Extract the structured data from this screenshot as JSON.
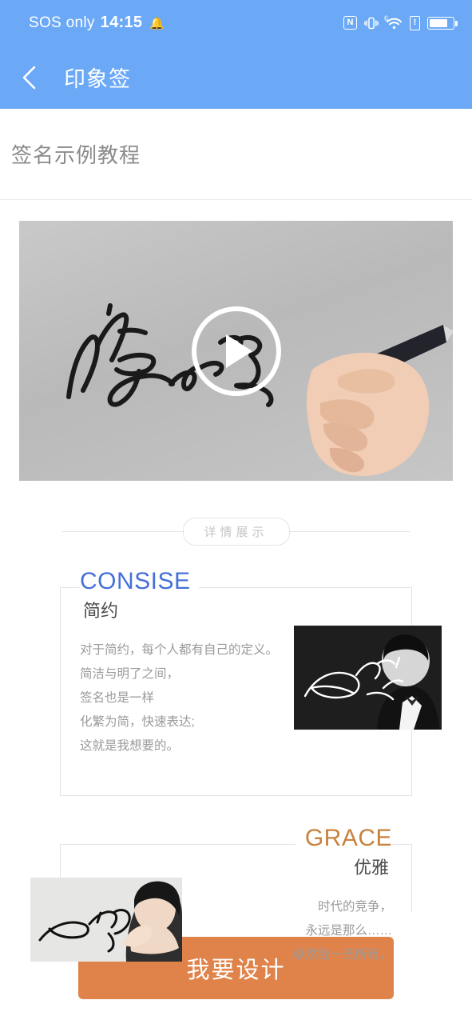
{
  "status_bar": {
    "carrier": "SOS only",
    "time": "14:15",
    "bell_icon": "bell-icon",
    "nfc_label": "N",
    "wifi_generation": "6",
    "alert_label": "!"
  },
  "nav": {
    "back_icon": "chevron-left-icon",
    "title": "印象签"
  },
  "section": {
    "title": "签名示例教程"
  },
  "video": {
    "play_icon": "play-icon",
    "alt": "手写签名演示视频"
  },
  "divider": {
    "label": "详情展示"
  },
  "cards": [
    {
      "en": "CONSISE",
      "cn": "简约",
      "accent": "#4670d8",
      "align": "left",
      "lines": [
        "对于简约，每个人都有自己的定义。",
        "简洁与明了之间，",
        "签名也是一样",
        "化繁为简，快速表达;",
        "这就是我想要的。"
      ],
      "photo_alt": "黑白人像签名示例"
    },
    {
      "en": "GRACE",
      "cn": "优雅",
      "accent": "#c8823f",
      "align": "right",
      "lines": [
        "时代的竞争，",
        "永远是那么……",
        "纵然我一无所有，"
      ],
      "photo_alt": "女性人像签名示例"
    }
  ],
  "cta": {
    "label": "我要设计"
  },
  "colors": {
    "header_blue": "#6ba9f7",
    "cta_orange": "#e0834a",
    "consise_blue": "#4670d8",
    "grace_orange": "#c8823f",
    "body_gray": "#9a9a9a",
    "title_gray": "#8b8b8b"
  }
}
